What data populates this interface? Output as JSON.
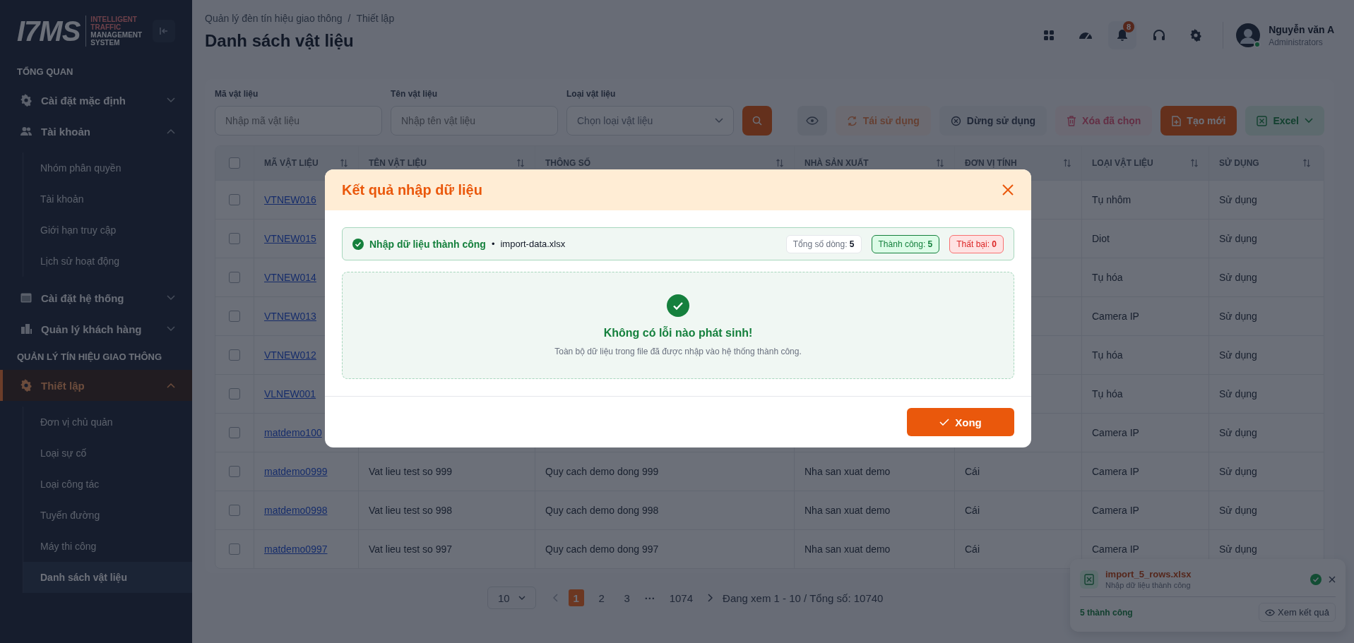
{
  "sidebar": {
    "logo": {
      "mark": "I7MS",
      "line_1": "INTELLIGENT",
      "line_2": "TRAFFIC",
      "line_3": "MANAGEMENT",
      "line_4": "SYSTEM"
    },
    "sections": [
      {
        "title": "TỔNG QUAN",
        "items": [
          {
            "label": "Cài đặt mặc định",
            "expanded": false,
            "selected": false
          },
          {
            "label": "Tài khoản",
            "expanded": true,
            "selected": false,
            "children": [
              {
                "label": "Nhóm phân quyền",
                "selected": false
              },
              {
                "label": "Tài khoản",
                "selected": false
              },
              {
                "label": "Giới hạn truy cập",
                "selected": false
              },
              {
                "label": "Lịch sử hoạt động",
                "selected": false
              }
            ]
          },
          {
            "label": "Cài đặt hệ thống",
            "expanded": false,
            "selected": false
          },
          {
            "label": "Quản lý khách hàng",
            "expanded": false,
            "selected": false
          }
        ]
      },
      {
        "title": "QUẢN LÝ TÍN HIỆU GIAO THÔNG",
        "items": [
          {
            "label": "Thiết lập",
            "expanded": true,
            "selected": true,
            "children": [
              {
                "label": "Đơn vị chủ quản",
                "selected": false
              },
              {
                "label": "Loại sự cố",
                "selected": false
              },
              {
                "label": "Loại công tác",
                "selected": false
              },
              {
                "label": "Tuyến đường",
                "selected": false
              },
              {
                "label": "Máy thi công",
                "selected": false
              },
              {
                "label": "Danh sách vật liệu",
                "selected": true
              }
            ]
          }
        ]
      }
    ]
  },
  "header": {
    "breadcrumb": {
      "items": [
        "Quản lý đèn tín hiệu giao thông",
        "Thiết lập"
      ],
      "separator": "/"
    },
    "title": "Danh sách vật liệu",
    "notification_count": "8",
    "user": {
      "name": "Nguyễn văn A",
      "role": "Administrators",
      "online": true
    }
  },
  "filters": [
    {
      "label": "Mã vật liệu",
      "placeholder": "Nhập mã vật liệu",
      "kind": "text"
    },
    {
      "label": "Tên vật liệu",
      "placeholder": "Nhập tên vật liệu",
      "kind": "text"
    },
    {
      "label": "Loại vật liệu",
      "placeholder": "Chọn loại vật liệu",
      "kind": "select"
    }
  ],
  "toolbar": [
    {
      "kind": "view",
      "disabled": false
    },
    {
      "label": "Tái sử dụng",
      "kind": "reuse",
      "disabled": true
    },
    {
      "label": "Dừng sử dụng",
      "kind": "stop",
      "disabled": false
    },
    {
      "label": "Xóa đã chọn",
      "kind": "delete",
      "disabled": true
    },
    {
      "label": "Tạo mới",
      "kind": "create",
      "disabled": false
    },
    {
      "label": "Excel",
      "kind": "excel",
      "disabled": false
    }
  ],
  "table": {
    "select_all_checked": false,
    "columns": [
      "MÃ VẬT LIỆU",
      "TÊN VẬT LIỆU",
      "THÔNG SỐ",
      "NHÀ SẢN XUẤT",
      "ĐƠN VỊ TÍNH",
      "LOẠI VẬT LIỆU",
      "SỬ DỤNG"
    ],
    "rows": [
      {
        "checked": false,
        "code": "VTNEW016",
        "type": "Tụ nhôm",
        "usage": "Sử dụng"
      },
      {
        "checked": false,
        "code": "VTNEW015",
        "type": "Diot",
        "usage": "Sử dụng"
      },
      {
        "checked": false,
        "code": "VTNEW014",
        "type": "Tụ hóa",
        "usage": "Sử dụng"
      },
      {
        "checked": false,
        "code": "VTNEW013",
        "type": "Camera IP",
        "usage": "Sử dụng"
      },
      {
        "checked": false,
        "code": "VTNEW012",
        "type": "Tụ hóa",
        "usage": "Sử dụng"
      },
      {
        "checked": false,
        "code": "VLNEW001",
        "type": "Tụ hóa",
        "usage": "Sử dụng"
      },
      {
        "checked": false,
        "code": "matdemo100",
        "type": "Camera IP",
        "usage": "Sử dụng"
      },
      {
        "checked": false,
        "code": "matdemo0999",
        "name": "Vat lieu test so 999",
        "spec": "Quy cach demo dong 999",
        "maker": "Nha san xuat demo",
        "unit": "Cái",
        "type": "Camera IP",
        "usage": "Sử dụng"
      },
      {
        "checked": false,
        "code": "matdemo0998",
        "name": "Vat lieu test so 998",
        "spec": "Quy cach demo dong 998",
        "maker": "Nha san xuat demo",
        "unit": "Cái",
        "type": "Camera IP",
        "usage": "Sử dụng"
      },
      {
        "checked": false,
        "code": "matdemo0997",
        "name": "Vat lieu test so 997",
        "spec": "Quy cach demo dong 997",
        "maker": "Nha san xuat demo",
        "unit": "Cái",
        "type": "Camera IP",
        "usage": "Sử dụng"
      }
    ]
  },
  "pagination": {
    "page_size": "10",
    "pages": [
      {
        "label": "1",
        "kind": "page",
        "selected": true
      },
      {
        "label": "2",
        "kind": "page",
        "selected": false
      },
      {
        "label": "3",
        "kind": "page",
        "selected": false
      },
      {
        "label": "···",
        "kind": "ellipsis"
      },
      {
        "label": "1074",
        "kind": "page",
        "selected": false
      }
    ],
    "summary": "Đang xem 1 - 10 / Tổng số: 10740"
  },
  "toast": {
    "file": "import_5_rows.xlsx",
    "message": "Nhập dữ liệu thành công",
    "result": "5 thành công",
    "action": "Xem kết quả"
  },
  "modal": {
    "title": "Kết quả nhập dữ liệu",
    "status": "Nhập dữ liệu thành công",
    "bullet": "•",
    "file": "import-data.xlsx",
    "chips": [
      {
        "kind": "total",
        "text": "Tổng số dòng: **5**"
      },
      {
        "kind": "success",
        "text": "Thành công: **5**"
      },
      {
        "kind": "failed",
        "text": "Thất bại: **0**"
      }
    ],
    "empty_title": "Không có lỗi nào phát sinh!",
    "empty_text": "Toàn bộ dữ liệu trong file đã được nhập vào hệ thống thành công.",
    "confirm": "Xong"
  }
}
